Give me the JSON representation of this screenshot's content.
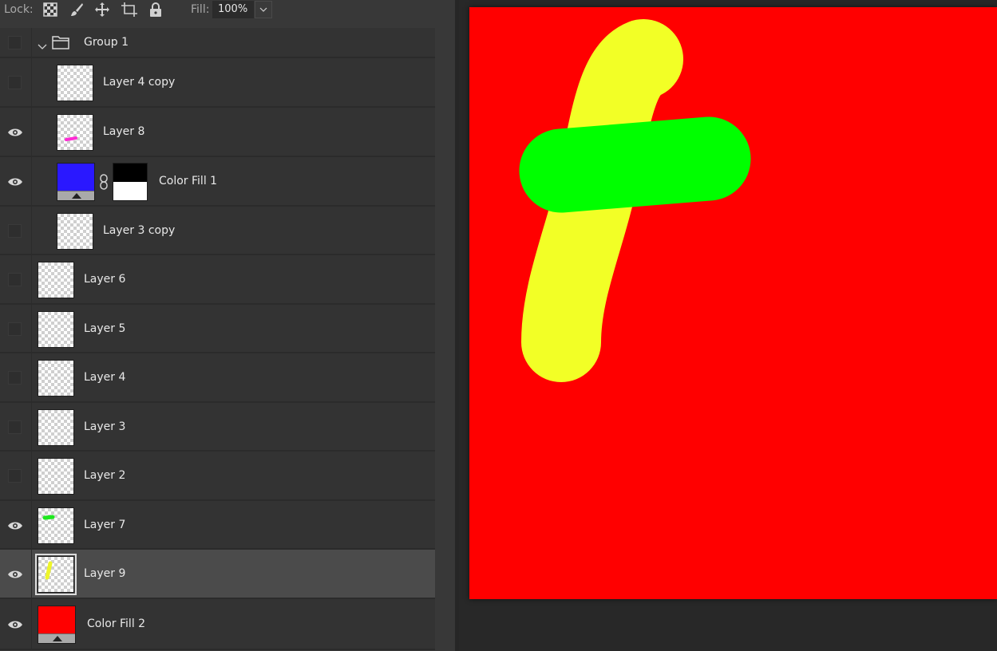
{
  "toolbar": {
    "lock_label": "Lock:",
    "fill_label": "Fill:",
    "fill_value": "100%",
    "lock_icons": [
      "lock-transparent-pixels-icon",
      "lock-image-pixels-icon",
      "lock-position-icon",
      "lock-artboard-icon",
      "lock-all-icon"
    ]
  },
  "layers": [
    {
      "name": "Group 1",
      "type": "group",
      "visible": false,
      "expanded": true
    },
    {
      "name": "Layer 4 copy",
      "type": "pixel",
      "visible": false,
      "in_group": true
    },
    {
      "name": "Layer 8",
      "type": "pixel",
      "visible": true,
      "in_group": true,
      "thumb_mark": "#ff2ad4"
    },
    {
      "name": "Color Fill 1",
      "type": "fill",
      "visible": true,
      "in_group": true,
      "fill_color": "#2a18ff",
      "has_mask": true,
      "linked": true
    },
    {
      "name": "Layer 3 copy",
      "type": "pixel",
      "visible": false,
      "in_group": true
    },
    {
      "name": "Layer 6",
      "type": "pixel",
      "visible": false
    },
    {
      "name": "Layer 5",
      "type": "pixel",
      "visible": false
    },
    {
      "name": "Layer 4",
      "type": "pixel",
      "visible": false
    },
    {
      "name": "Layer 3",
      "type": "pixel",
      "visible": false
    },
    {
      "name": "Layer 2",
      "type": "pixel",
      "visible": false
    },
    {
      "name": "Layer 7",
      "type": "pixel",
      "visible": true,
      "thumb_mark": "#1ee81e"
    },
    {
      "name": "Layer 9",
      "type": "pixel",
      "visible": true,
      "selected": true,
      "thumb_mark": "#eef52a"
    },
    {
      "name": "Color Fill 2",
      "type": "fill",
      "visible": true,
      "fill_color": "#ff0000"
    }
  ],
  "canvas": {
    "background": "#ff0000",
    "strokes": [
      {
        "layer": "Layer 9",
        "color": "#f2ff26"
      },
      {
        "layer": "Layer 7",
        "color": "#00ff00"
      }
    ]
  }
}
